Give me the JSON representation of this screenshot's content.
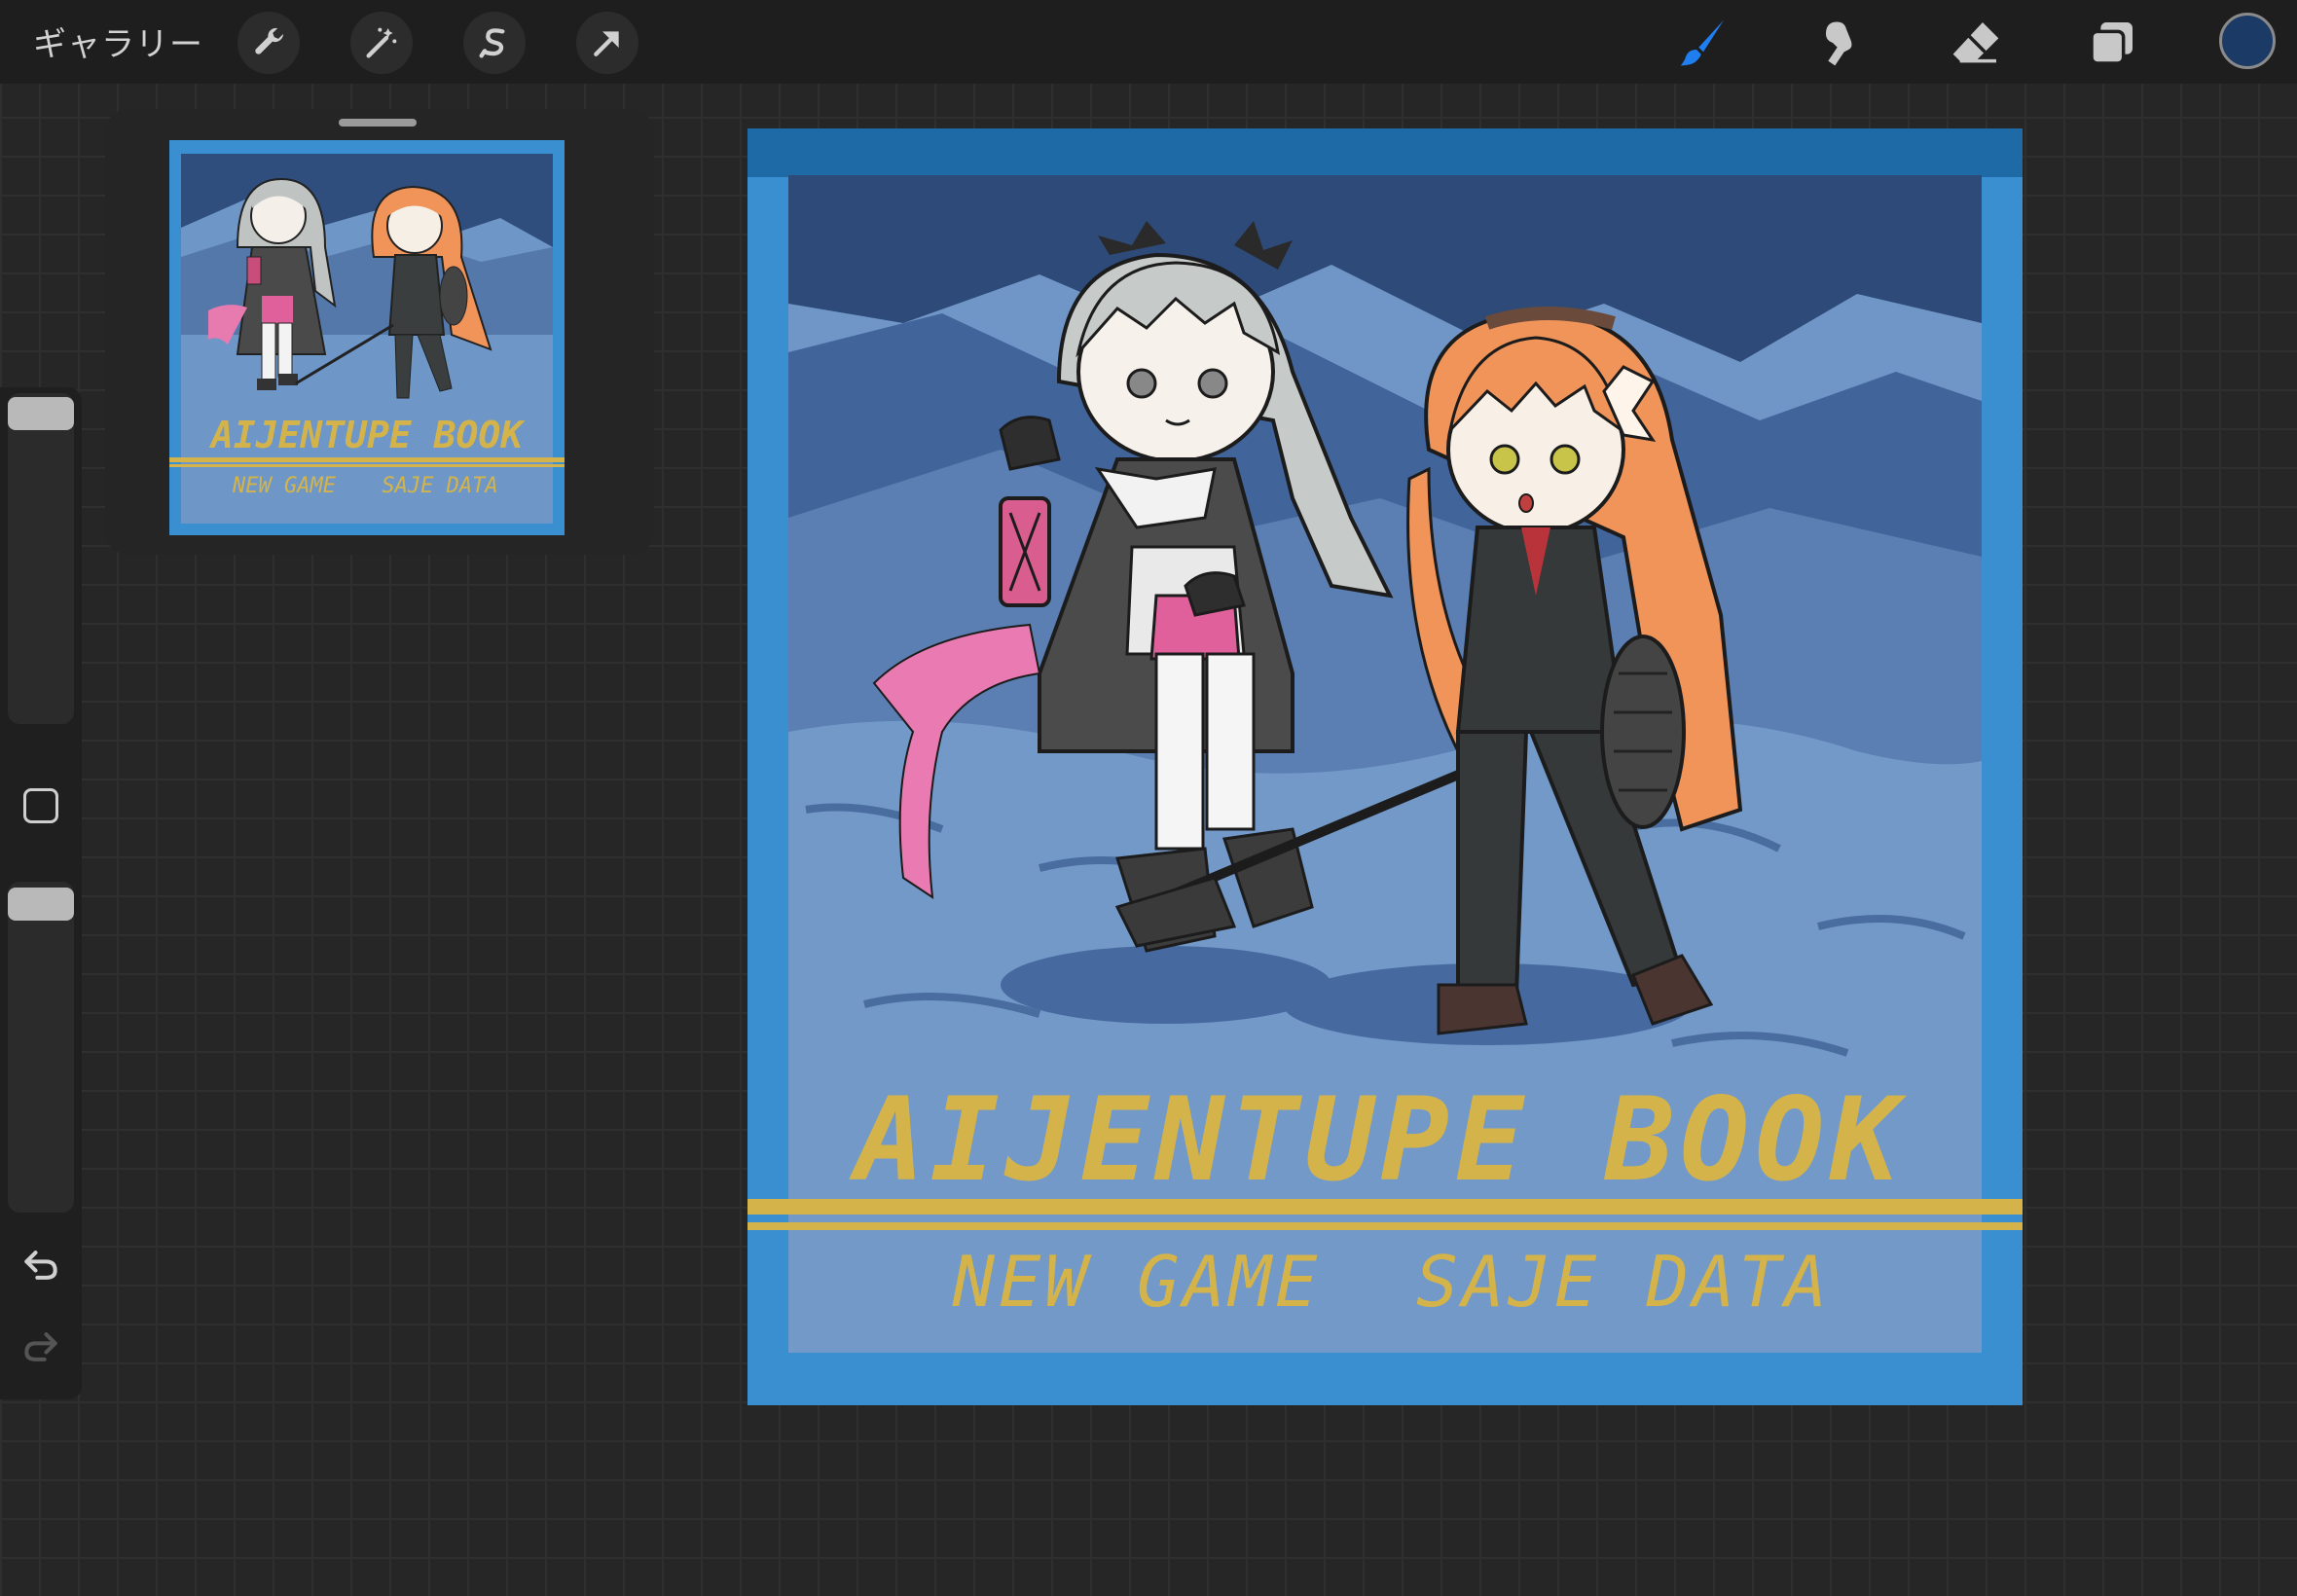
{
  "toolbar": {
    "gallery_label": "ギャラリー",
    "left_tools": [
      "wrench-icon",
      "magic-wand-icon",
      "selection-icon",
      "move-arrow-icon"
    ],
    "right_tools": [
      "brush-icon",
      "smudge-icon",
      "eraser-icon",
      "layers-icon"
    ],
    "active_tool": "brush-icon",
    "active_tool_color": "#1f7ff0",
    "current_color": "#1b3a66"
  },
  "sidebar": {
    "brush_size_icon": "slider-icon",
    "modifier_icon": "square-icon",
    "opacity_icon": "slider-icon",
    "undo_icon": "undo-icon",
    "redo_icon": "redo-icon"
  },
  "artwork": {
    "title": "AIJENTUPE BOOK",
    "menu_left": "NEW GAME",
    "menu_right": "SAJE DATA",
    "text_color": "#d4b44a",
    "frame_color": "#3a8fd0"
  },
  "reference": {
    "title": "AIJENTUPE BOOK",
    "menu_left": "NEW GAME",
    "menu_right": "SAJE DATA"
  }
}
